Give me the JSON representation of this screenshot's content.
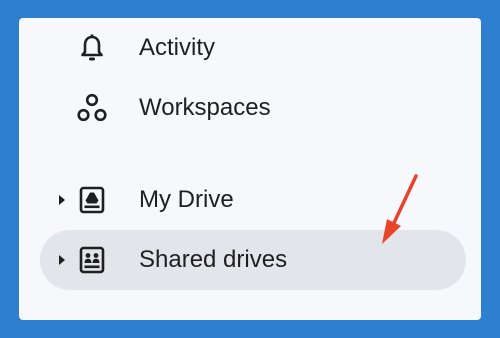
{
  "colors": {
    "frame": "#2f7fd0",
    "panel": "#f6f8fc",
    "selected_bg": "#e2e5ea",
    "text": "#1f1f1f",
    "arrow": "#e8432b"
  },
  "nav": {
    "items": [
      {
        "label": "Activity",
        "icon": "bell-icon"
      },
      {
        "label": "Workspaces",
        "icon": "workspaces-icon"
      },
      {
        "label": "My Drive",
        "icon": "my-drive-icon",
        "expandable": true
      },
      {
        "label": "Shared drives",
        "icon": "shared-drives-icon",
        "expandable": true,
        "selected": true
      }
    ]
  },
  "annotation": {
    "icon": "red-arrow-icon"
  }
}
